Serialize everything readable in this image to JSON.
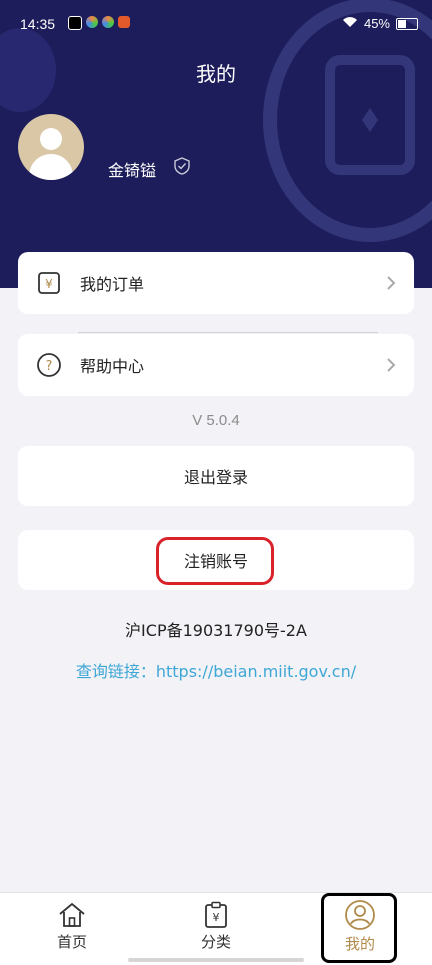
{
  "status_bar": {
    "time": "14:35",
    "battery": "45%"
  },
  "header": {
    "title": "我的"
  },
  "profile": {
    "username": "金锜镒"
  },
  "menu": {
    "orders_label": "我的订单",
    "help_label": "帮助中心"
  },
  "version": "V 5.0.4",
  "actions": {
    "logout_label": "退出登录",
    "cancel_account_label": "注销账号"
  },
  "footer": {
    "icp": "沪ICP备19031790号-2A",
    "link_text": "查询链接：https://beian.miit.gov.cn/"
  },
  "tabs": [
    {
      "label": "首页",
      "icon": "home-icon"
    },
    {
      "label": "分类",
      "icon": "category-icon"
    },
    {
      "label": "我的",
      "icon": "profile-icon",
      "active": true
    }
  ],
  "colors": {
    "header_bg": "#1c1d5a",
    "accent_gold": "#b08a4a",
    "link_blue": "#3fa7d6",
    "highlight_red": "#d8232a"
  }
}
